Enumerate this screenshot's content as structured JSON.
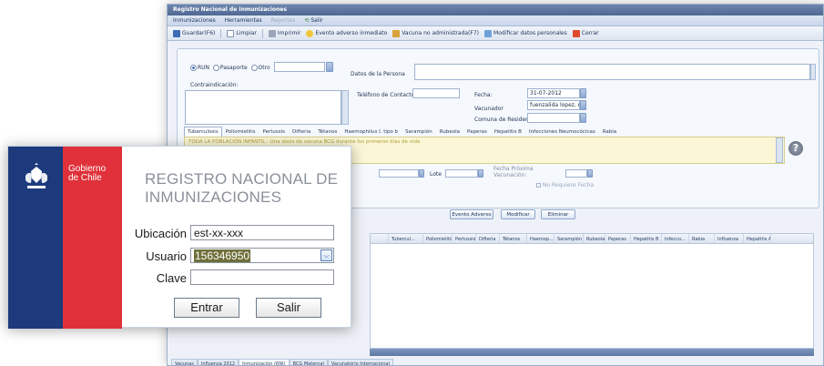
{
  "app": {
    "title": "Registro Nacional de Inmunizaciones",
    "menu": {
      "inmunizaciones": "Inmunizaciones",
      "herramientas": "Herramientas",
      "hidden_item": "Reportes",
      "salir": "Salir"
    },
    "toolbar": {
      "guardar": "Guardar(F6)",
      "limpiar": "Limpiar",
      "imprimir": "Imprimir",
      "evento": "Evento adverso inmediato",
      "vacuna_no": "Vacuna no administrada(F7)",
      "modificar_datos": "Modificar datos personales",
      "cerrar": "Cerrar"
    },
    "doc_type": {
      "run": "RUN",
      "pasaporte": "Pasaporte",
      "otro": "Otro",
      "selected": "RUN"
    },
    "labels": {
      "datos_persona": "Datos de la Persona",
      "contraindicacion": "Contraindicación:",
      "telefono": "Teléfono de Contacto",
      "fecha": "Fecha:",
      "vacunador": "Vacunador",
      "comuna": "Comuna de Residencia",
      "lote": "Lote",
      "fecha_proxima": "Fecha Próxima",
      "vacunacion": "Vacunación:",
      "no_requiere": "No Requiere Fecha"
    },
    "values": {
      "fecha": "31-07-2012",
      "vacunador": "fuenzalida lopez, m..."
    },
    "tabs": [
      "Tuberculosis",
      "Poliomielitis",
      "Pertussis",
      "Difteria",
      "Tétanos",
      "Haemophilus I. tipo b",
      "Sarampión",
      "Rubeola",
      "Paperas",
      "Hepatitis B",
      "Infecciones Neumocócicas",
      "Rabia"
    ],
    "active_tab": "Tuberculosis",
    "info_text": "TODA LA POBLACIÓN INFANTIL : Una dosis de vacuna BCG durante los primeros días de vida",
    "help_glyph": "?",
    "actions": {
      "evento_adverso": "Evento Adverso",
      "modificar": "Modificar",
      "eliminar": "Eliminar"
    },
    "grid_columns": [
      "Tubercul...",
      "Poliomielitis",
      "Pertussis",
      "Difteria",
      "Tétanos",
      "Haemop...",
      "Sarampión",
      "Rubeola",
      "Paperas",
      "Hepatitis B",
      "Infecco...",
      "Rabia",
      "Influenza",
      "Hepatitis A"
    ],
    "bottom_tabs": [
      "Vacunas",
      "Influenza 2012",
      "Inmunización (RNI)",
      "BCG Maternal",
      "Vacunatorio Internacional"
    ],
    "active_bottom_tab": "Inmunización (RNI)"
  },
  "login": {
    "logo_line1": "Gobierno",
    "logo_line2": "de Chile",
    "title_line1": "REGISTRO NACIONAL DE",
    "title_line2": "INMUNIZACIONES",
    "ubicacion_label": "Ubicación",
    "ubicacion_value": "est-xx-xxx",
    "usuario_label": "Usuario",
    "usuario_value": "156346950",
    "clave_label": "Clave",
    "clave_value": "",
    "entrar": "Entrar",
    "salir": "Salir"
  },
  "colors": {
    "chile_blue": "#1d3a7c",
    "chile_red": "#e0313a",
    "app_header": "#4f6892"
  }
}
